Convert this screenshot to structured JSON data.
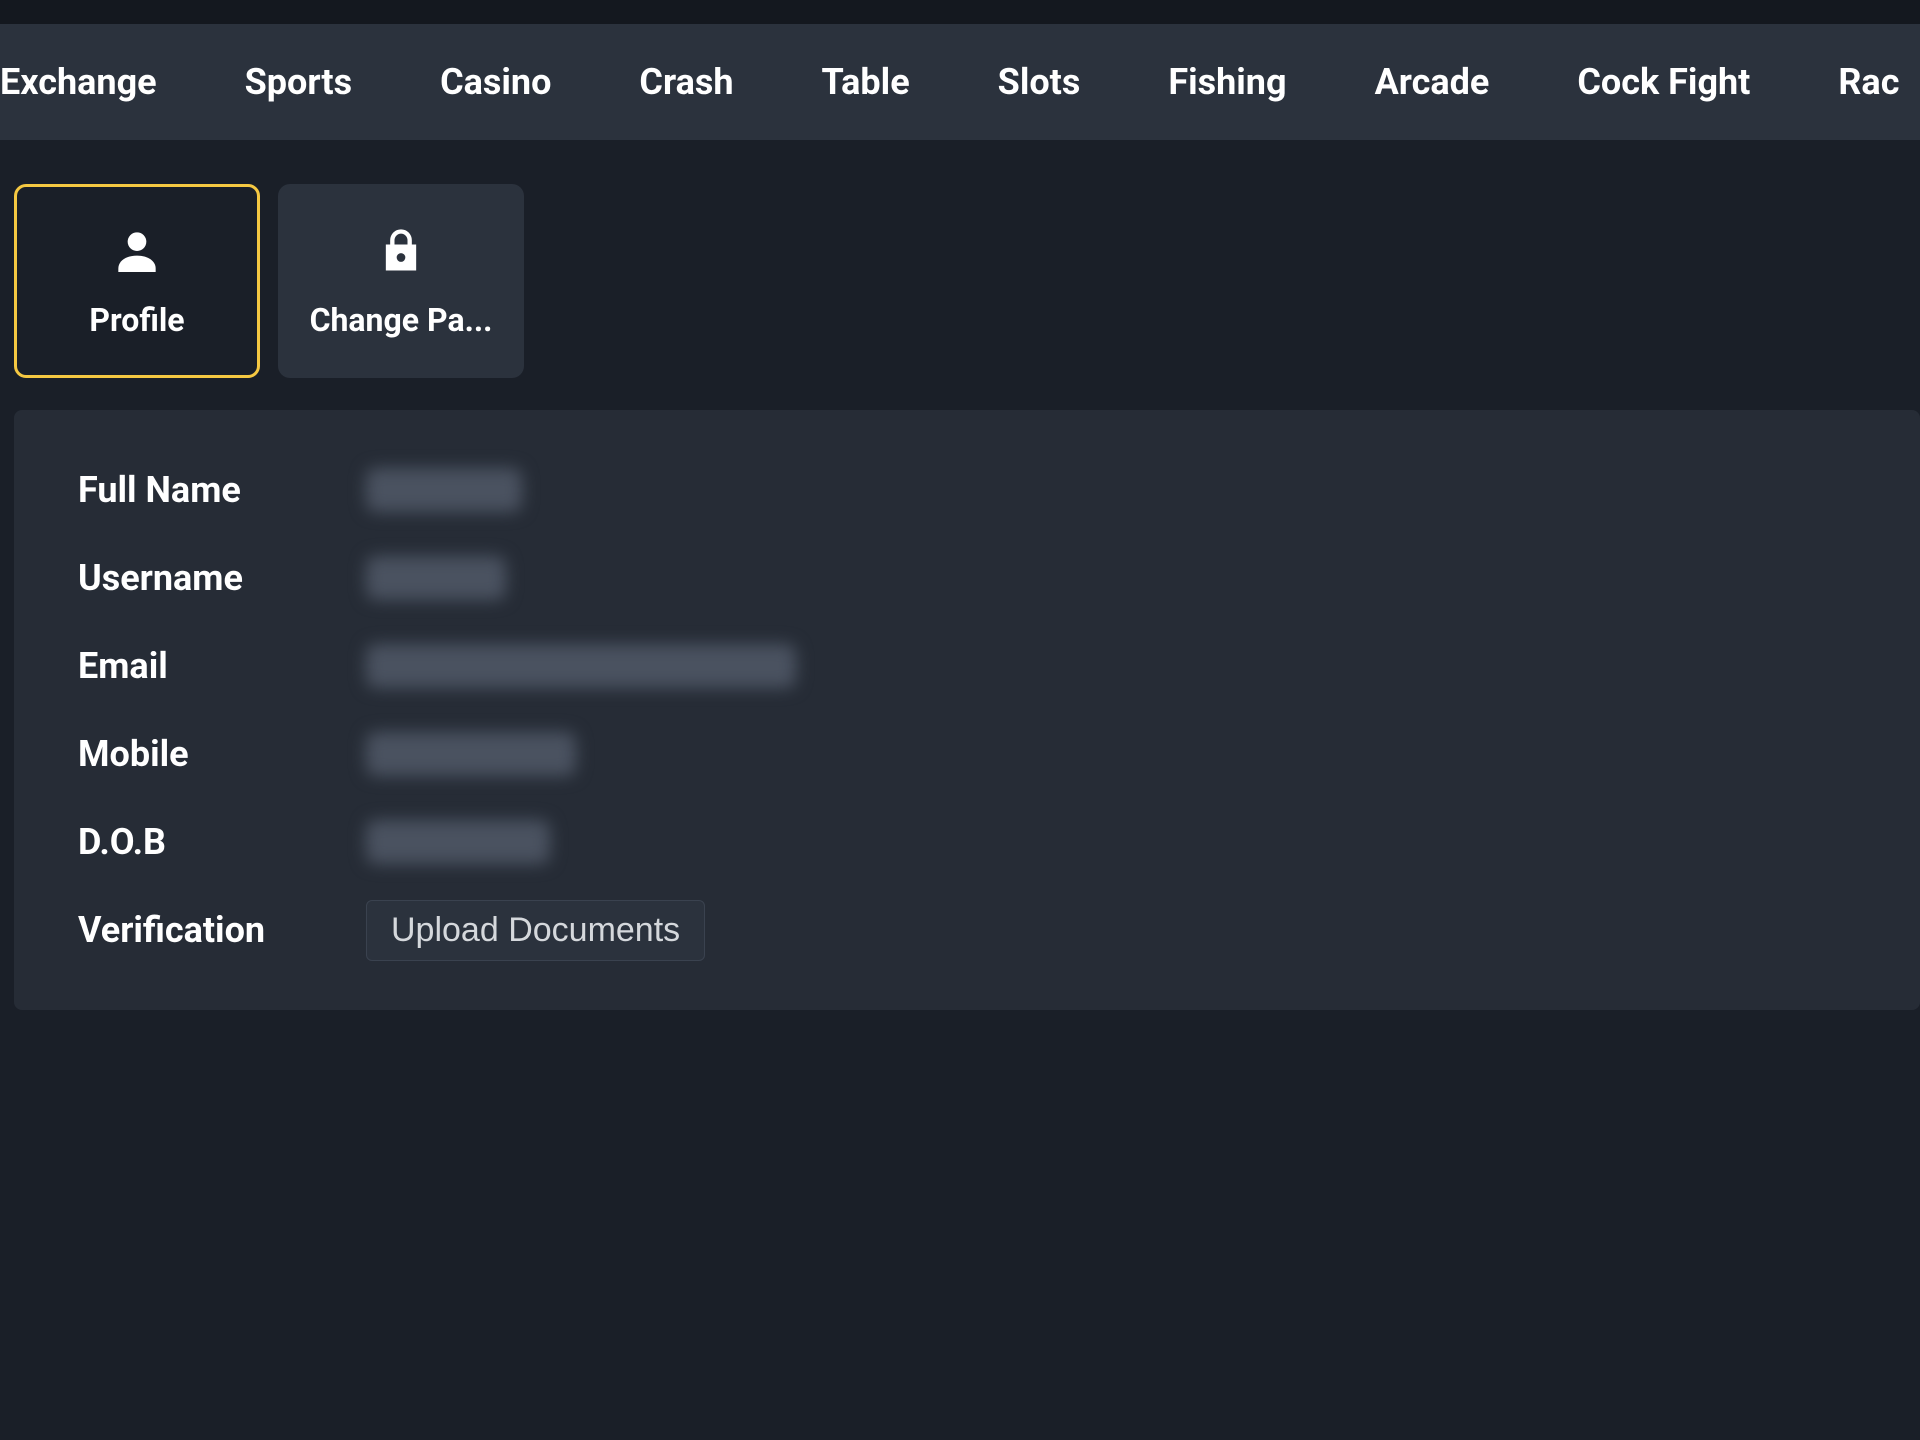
{
  "nav": {
    "items": [
      "Exchange",
      "Sports",
      "Casino",
      "Crash",
      "Table",
      "Slots",
      "Fishing",
      "Arcade",
      "Cock Fight",
      "Rac"
    ]
  },
  "tabs": {
    "profile": {
      "label": "Profile",
      "icon": "person-icon",
      "active": true
    },
    "change_password": {
      "label": "Change Pa...",
      "icon": "lock-icon",
      "active": false
    }
  },
  "profile": {
    "fields": [
      {
        "label": "Full Name",
        "redacted_class": "redacted-1"
      },
      {
        "label": "Username",
        "redacted_class": "redacted-2"
      },
      {
        "label": "Email",
        "redacted_class": "redacted-3"
      },
      {
        "label": "Mobile",
        "redacted_class": "redacted-4"
      },
      {
        "label": "D.O.B",
        "redacted_class": "redacted-5"
      }
    ],
    "verification_label": "Verification",
    "upload_label": "Upload Documents"
  },
  "colors": {
    "accent": "#f5c842",
    "bg": "#1a1f28",
    "panel": "#262c36",
    "nav": "#2b323d"
  }
}
